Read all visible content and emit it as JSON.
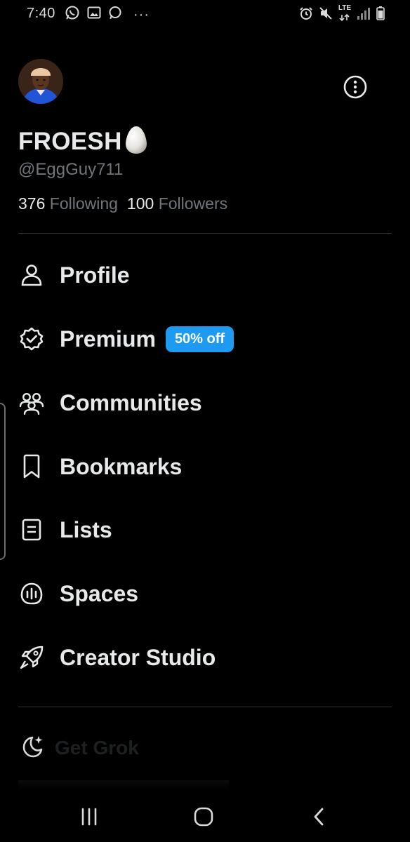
{
  "status_bar": {
    "time": "7:40",
    "left_icons": [
      "whatsapp-icon",
      "gallery-icon",
      "chat-bubble-icon"
    ],
    "more_indicator": "···",
    "right_icons": [
      "alarm-icon",
      "mute-icon",
      "lte-icon",
      "signal-icon",
      "battery-icon"
    ],
    "lte_label": "LTE"
  },
  "profile": {
    "display_name": "FROESH",
    "name_emoji": "egg-icon",
    "handle": "@EggGuy711",
    "following_count": "376",
    "following_label": "Following",
    "followers_count": "100",
    "followers_label": "Followers"
  },
  "nav": {
    "items": [
      {
        "label": "Profile",
        "icon": "person-icon"
      },
      {
        "label": "Premium",
        "icon": "verified-badge-icon",
        "badge": "50% off"
      },
      {
        "label": "Communities",
        "icon": "communities-icon"
      },
      {
        "label": "Bookmarks",
        "icon": "bookmark-icon"
      },
      {
        "label": "Lists",
        "icon": "list-icon"
      },
      {
        "label": "Spaces",
        "icon": "spaces-icon"
      },
      {
        "label": "Creator Studio",
        "icon": "rocket-icon"
      }
    ]
  },
  "secondary": {
    "grok_label": "Get Grok",
    "grok_icon": "moon-sparkle-icon"
  },
  "colors": {
    "background": "#000000",
    "text_primary": "#e7e9ea",
    "text_secondary": "#71767b",
    "accent": "#1d9bf0",
    "divider": "#2f3336"
  },
  "system_nav": {
    "buttons": [
      "recent-apps-icon",
      "home-icon",
      "back-icon"
    ]
  }
}
